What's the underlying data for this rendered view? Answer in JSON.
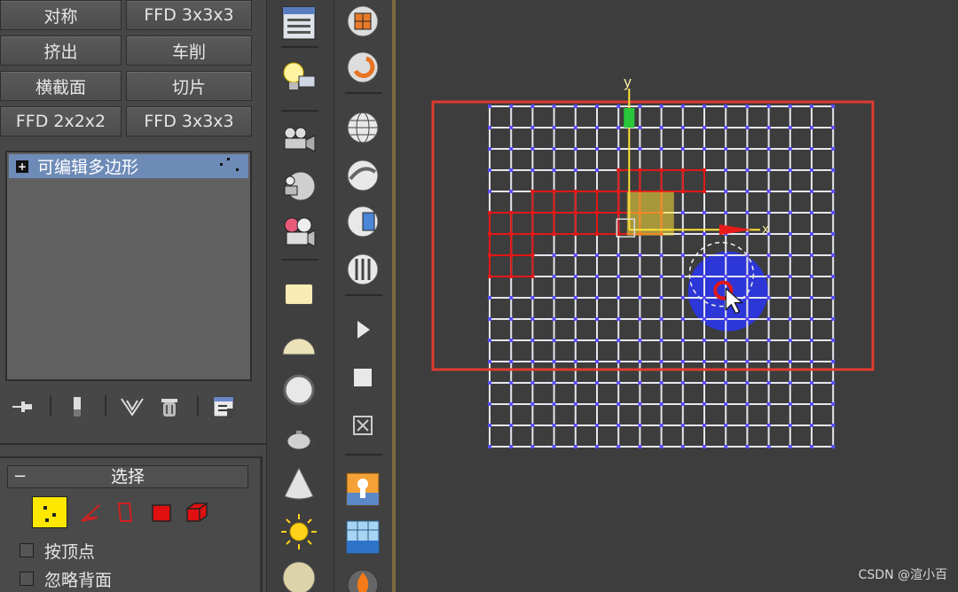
{
  "modifier_buttons": [
    [
      "对称",
      "FFD 3x3x3"
    ],
    [
      "挤出",
      "车削"
    ],
    [
      "横截面",
      "切片"
    ],
    [
      "FFD 2x2x2",
      "FFD 3x3x3"
    ]
  ],
  "stack": {
    "item_label": "可编辑多边形",
    "expand_glyph": "+"
  },
  "stack_tools": [
    "pin-stack-icon",
    "show-end-result-icon",
    "make-unique-icon",
    "remove-modifier-icon",
    "configure-modifier-sets-icon"
  ],
  "selection_rollout": {
    "collapse_glyph": "−",
    "title": "选择",
    "sub_objects": [
      "vertex-icon",
      "edge-icon",
      "border-icon",
      "polygon-icon",
      "element-icon"
    ],
    "checkboxes": [
      {
        "label": "按顶点",
        "checked": false
      },
      {
        "label": "忽略背面",
        "checked": false
      }
    ]
  },
  "toolbar_col1": [
    "rollout-panel-icon",
    "light-bulb-icon",
    "camera-icon",
    "sphere-camera-icon",
    "film-camera-icon",
    "rectangle-shape-icon",
    "hemisphere-icon",
    "sphere-icon",
    "teapot-icon",
    "cone-icon",
    "sun-icon",
    "disc-icon"
  ],
  "toolbar_col2": [
    "box-primitive-icon",
    "torus-icon",
    "geosphere-icon",
    "nurbs-surface-icon",
    "tube-icon",
    "pillar-icon",
    "play-icon",
    "stop-icon",
    "close-box-icon",
    "scene-orange-icon",
    "ocean-scene-icon",
    "fire-icon"
  ],
  "viewport": {
    "axis_y_label": "y",
    "axis_x_label": "x",
    "grid_cols": 16,
    "grid_rows": 16,
    "selection_rect_color": "#e03a2f",
    "selected_vertex_color": "#e01818",
    "normal_vertex_color": "#5a4cff",
    "gizmo_y_color": "#28c83a",
    "gizmo_x_color": "#e81b1b",
    "gizmo_center_color": "#ffe23a",
    "soft_select_color": "#2b35e8"
  },
  "watermark": "CSDN @渲小百"
}
